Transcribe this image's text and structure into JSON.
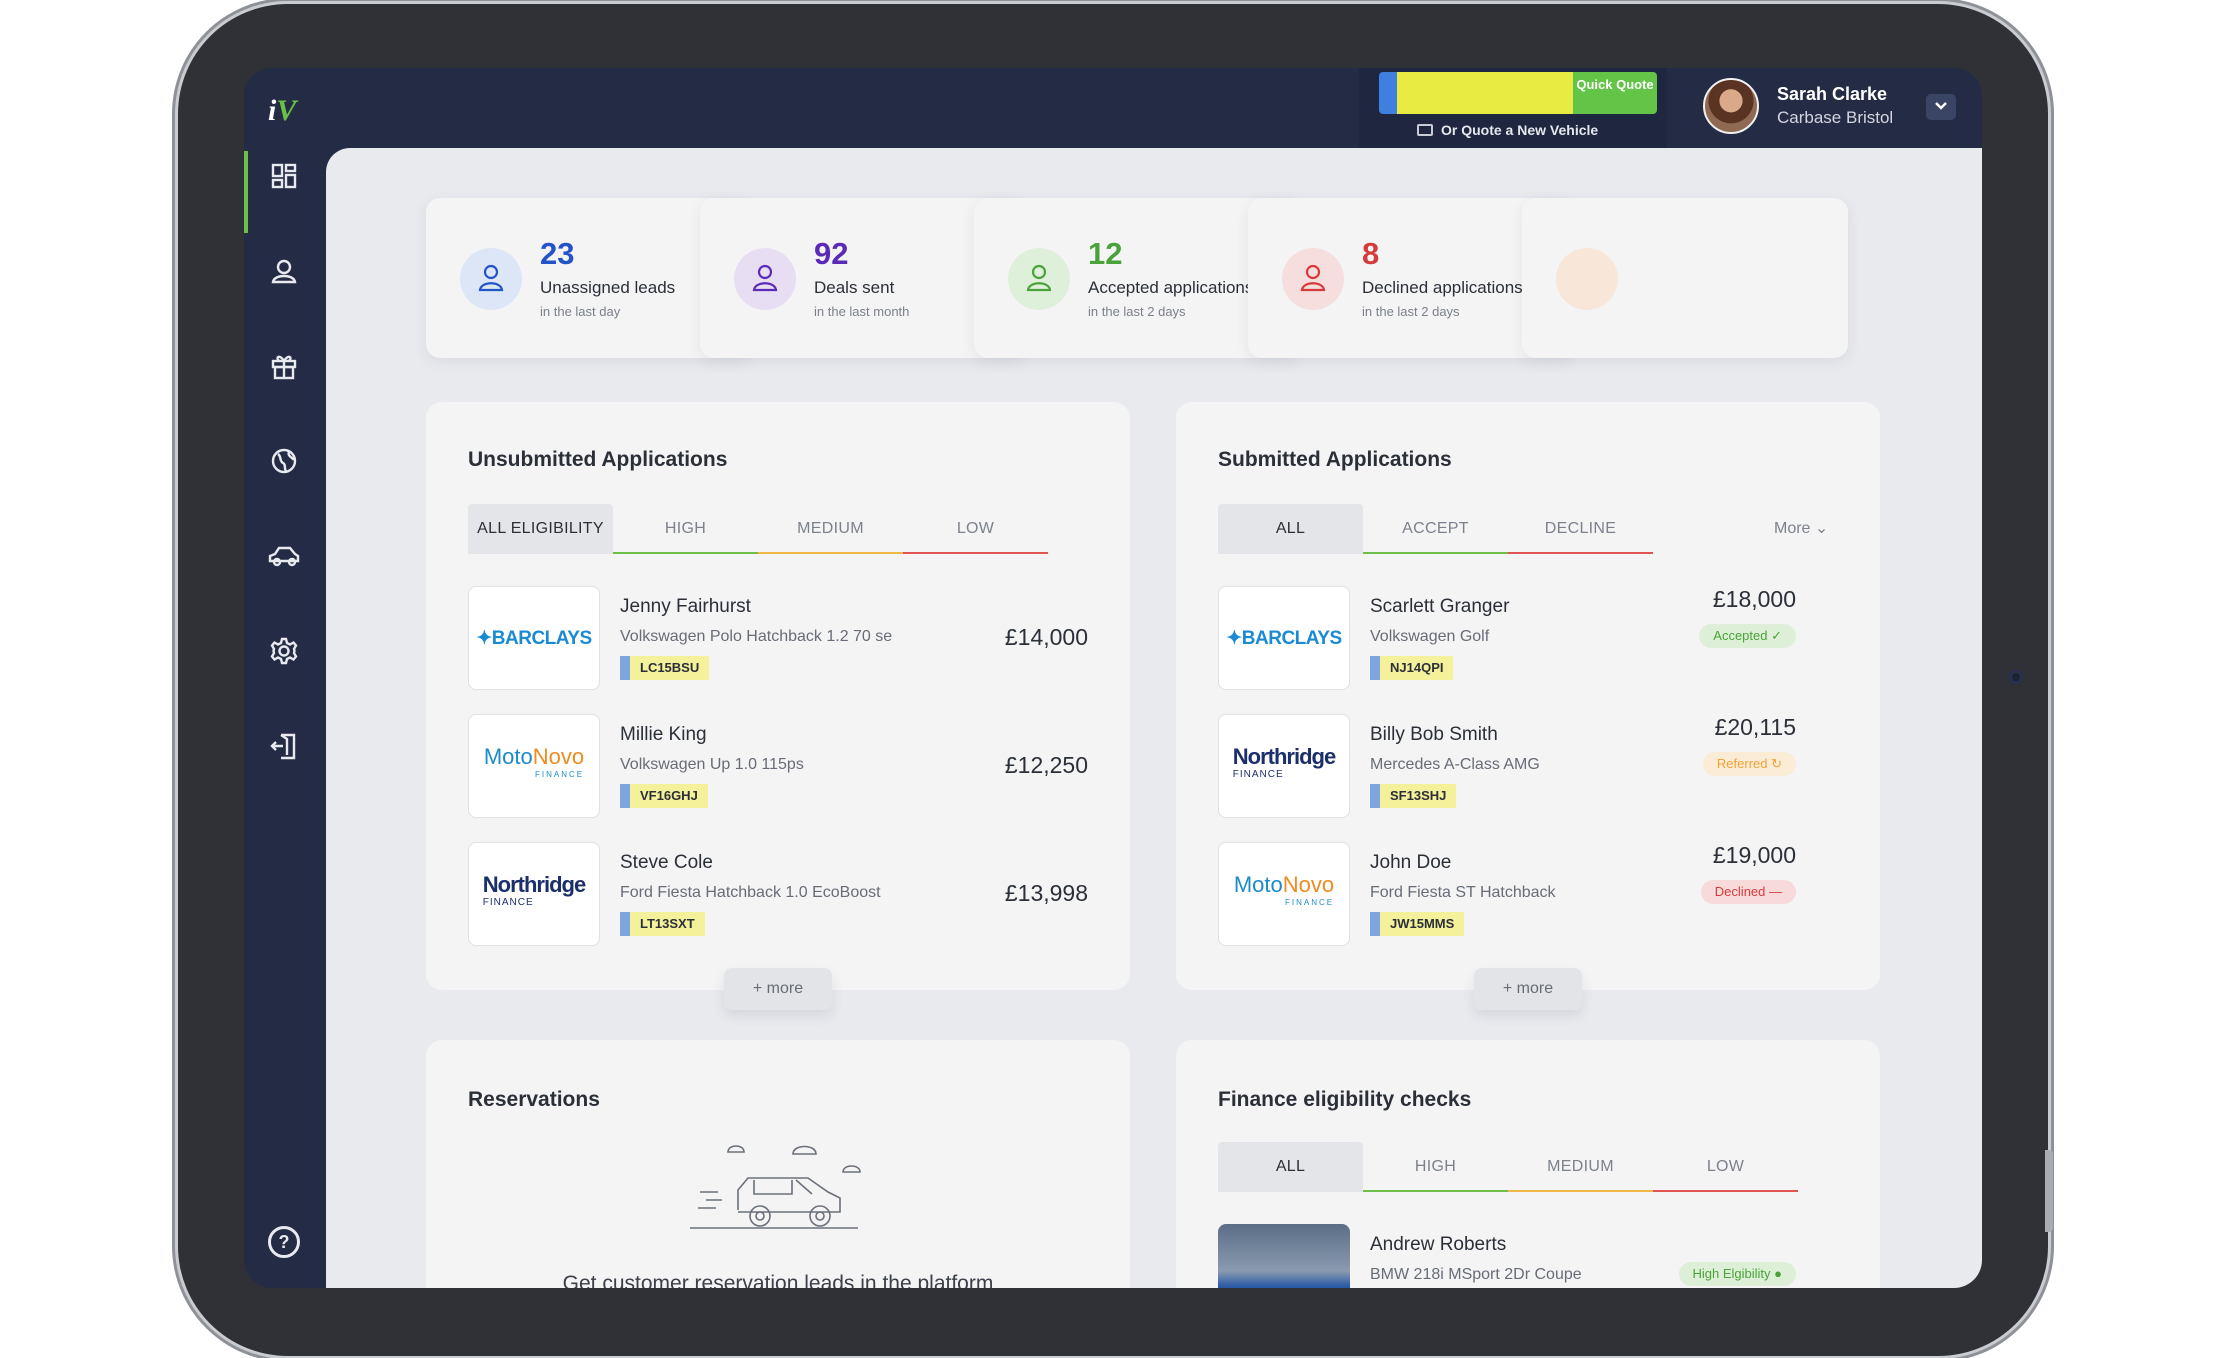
{
  "brand": {
    "logo_left": "i",
    "logo_right": "V"
  },
  "quote": {
    "quick_label": "Quick Quote",
    "new_vehicle_label": "Or Quote a New Vehicle"
  },
  "user": {
    "name": "Sarah Clarke",
    "org": "Carbase Bristol",
    "dropdown": "⌄"
  },
  "nav": {
    "items": [
      {
        "icon": "dashboard-icon",
        "active": true
      },
      {
        "icon": "customers-icon",
        "active": false
      },
      {
        "icon": "gift-icon",
        "active": false
      },
      {
        "icon": "globe-icon",
        "active": false
      },
      {
        "icon": "car-icon",
        "active": false
      },
      {
        "icon": "gear-icon",
        "active": false
      },
      {
        "icon": "logout-icon",
        "active": false
      }
    ],
    "help": "?"
  },
  "stats": [
    {
      "number": "23",
      "label": "Unassigned leads",
      "sub": "in the last day",
      "color": "#2453c9",
      "bg": "#dde6f6"
    },
    {
      "number": "92",
      "label": "Deals sent",
      "sub": "in the last month",
      "color": "#5b2bb8",
      "bg": "#e8def3"
    },
    {
      "number": "12",
      "label": "Accepted applications",
      "sub": "in the last 2 days",
      "color": "#4aa23a",
      "bg": "#dff0da"
    },
    {
      "number": "8",
      "label": "Declined applications",
      "sub": "in the last 2 days",
      "color": "#d63b3b",
      "bg": "#f6dede"
    }
  ],
  "unsubmitted": {
    "title": "Unsubmitted Applications",
    "tabs": [
      "ALL ELIGIBILITY",
      "HIGH",
      "MEDIUM",
      "LOW"
    ],
    "rows": [
      {
        "lender": "BARCLAYS",
        "name": "Jenny Fairhurst",
        "car": "Volkswagen Polo Hatchback 1.2 70 se",
        "plate": "LC15BSU",
        "price": "£14,000"
      },
      {
        "lender": "MotoNovo",
        "name": "Millie King",
        "car": "Volkswagen Up 1.0 115ps",
        "plate": "VF16GHJ",
        "price": "£12,250"
      },
      {
        "lender": "Northridge",
        "name": "Steve Cole",
        "car": "Ford Fiesta Hatchback 1.0 EcoBoost",
        "plate": "LT13SXT",
        "price": "£13,998"
      }
    ],
    "more": "+  more"
  },
  "submitted": {
    "title": "Submitted Applications",
    "tabs": [
      "ALL",
      "ACCEPT",
      "DECLINE"
    ],
    "more_dropdown": "More ⌄",
    "rows": [
      {
        "lender": "BARCLAYS",
        "name": "Scarlett Granger",
        "car": "Volkswagen Golf",
        "plate": "NJ14QPI",
        "price": "£18,000",
        "status": "Accepted ✓",
        "status_color": "#4aa23a",
        "status_bg": "#ddf0d7"
      },
      {
        "lender": "Northridge",
        "name": "Billy Bob Smith",
        "car": "Mercedes A-Class AMG",
        "plate": "SF13SHJ",
        "price": "£20,115",
        "status": "Referred ↻",
        "status_color": "#f0a23a",
        "status_bg": "#fbecd5"
      },
      {
        "lender": "MotoNovo",
        "name": "John Doe",
        "car": "Ford Fiesta ST Hatchback",
        "plate": "JW15MMS",
        "price": "£19,000",
        "status": "Declined —",
        "status_color": "#d63b3b",
        "status_bg": "#f8dada"
      }
    ],
    "more": "+  more"
  },
  "reservations": {
    "title": "Reservations",
    "empty_text": "Get customer reservation leads in the platform"
  },
  "eligibility": {
    "title": "Finance eligibility checks",
    "tabs": [
      "ALL",
      "HIGH",
      "MEDIUM",
      "LOW"
    ],
    "rows": [
      {
        "name": "Andrew Roberts",
        "car": "BMW 218i MSport 2Dr Coupe",
        "status": "High Elgibility ●"
      }
    ]
  },
  "lender_logos": {
    "barclays": "BARCLAYS",
    "motonovo_a": "Moto",
    "motonovo_b": "Novo",
    "motonovo_sub": "FINANCE",
    "northridge": "Northridge",
    "northridge_sub": "FINANCE"
  }
}
